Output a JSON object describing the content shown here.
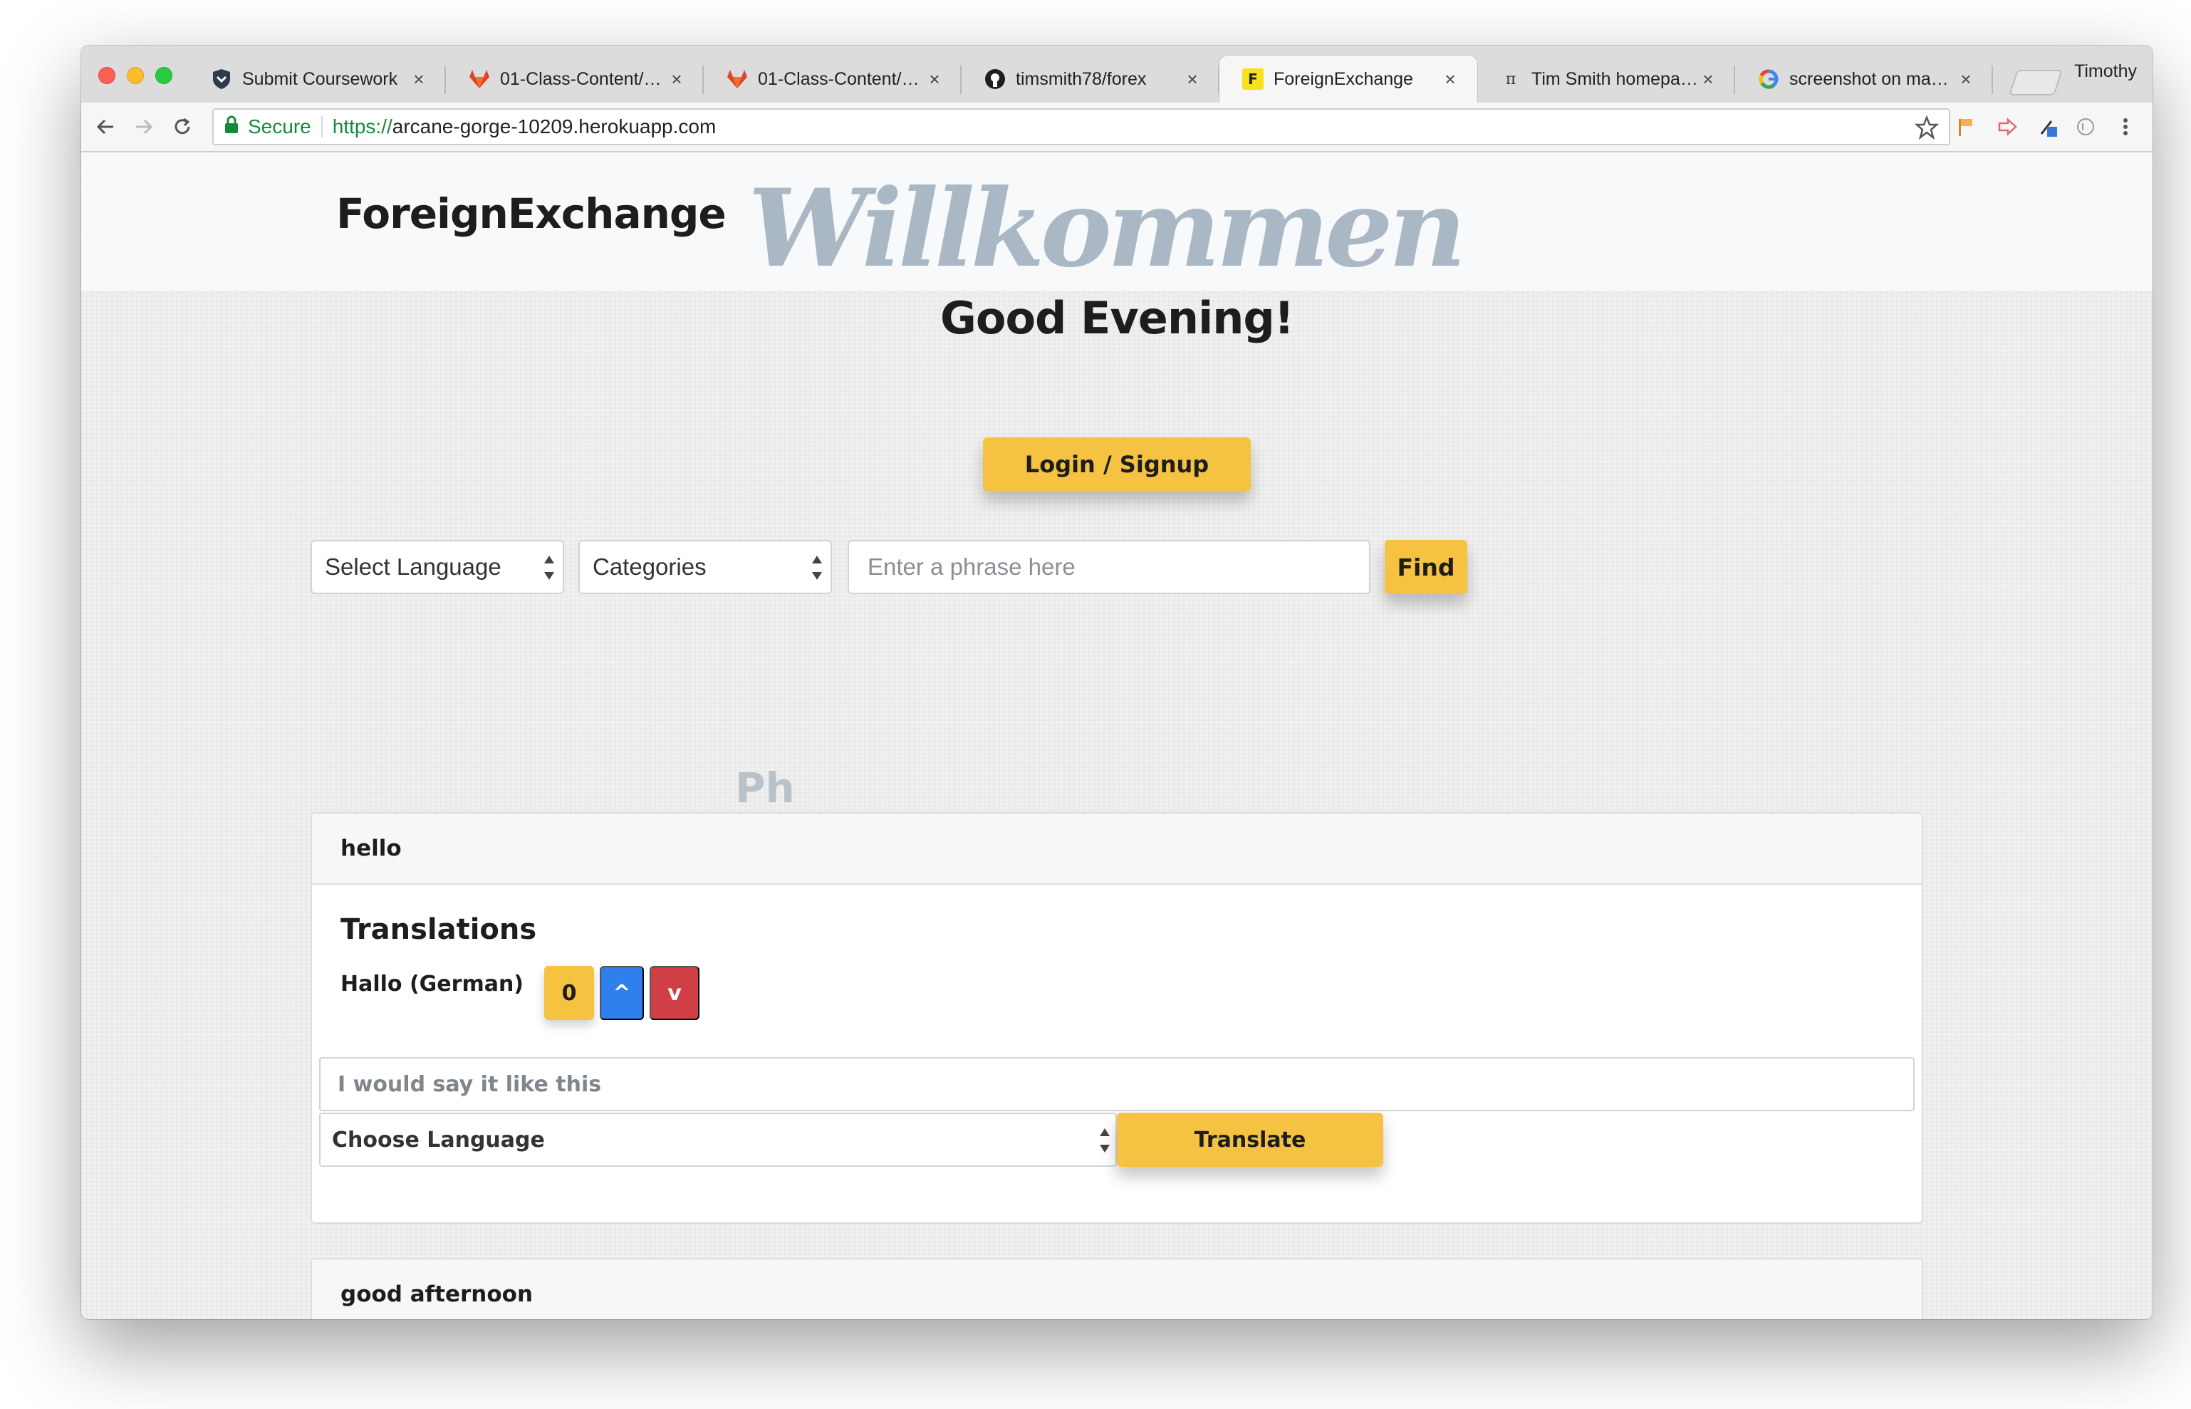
{
  "browser": {
    "tabs": [
      {
        "label": "Submit Coursework",
        "icon": "shield-icon"
      },
      {
        "label": "01-Class-Content/17-",
        "icon": "gitlab-icon"
      },
      {
        "label": "01-Class-Content/13-",
        "icon": "gitlab-icon"
      },
      {
        "label": "timsmith78/forex",
        "icon": "github-icon"
      },
      {
        "label": "ForeignExchange",
        "icon": "forex-favicon",
        "favicon_letter": "F",
        "active": true
      },
      {
        "label": "Tim Smith homepage",
        "icon": "pi-icon",
        "favicon_text": "π"
      },
      {
        "label": "screenshot on mac - G",
        "icon": "google-icon"
      }
    ],
    "profile_name": "Timothy",
    "address": {
      "secure_label": "Secure",
      "scheme": "https://",
      "host": "arcane-gorge-10209.herokuapp.com"
    }
  },
  "page": {
    "brand": "ForeignExchange",
    "welcome": "Willkommen",
    "greeting": "Good Evening!",
    "login_label": "Login / Signup",
    "search": {
      "language_select": "Select Language",
      "category_select": "Categories",
      "phrase_placeholder": "Enter a phrase here",
      "find_label": "Find"
    },
    "faded_heading": "Ph",
    "phrases": [
      {
        "phrase": "hello",
        "translations_title": "Translations",
        "translations": [
          {
            "text": "Hallo (German)",
            "votes": "0",
            "up_label": "^",
            "down_label": "v"
          }
        ],
        "suggest_placeholder": "I would say it like this",
        "language_select": "Choose Language",
        "translate_label": "Translate"
      },
      {
        "phrase": "good afternoon"
      }
    ]
  },
  "colors": {
    "accent_yellow": "#f5c242",
    "upvote_blue": "#2f80ed",
    "downvote_red": "#cf3f45",
    "welcome_script": "#a9b8c4"
  }
}
